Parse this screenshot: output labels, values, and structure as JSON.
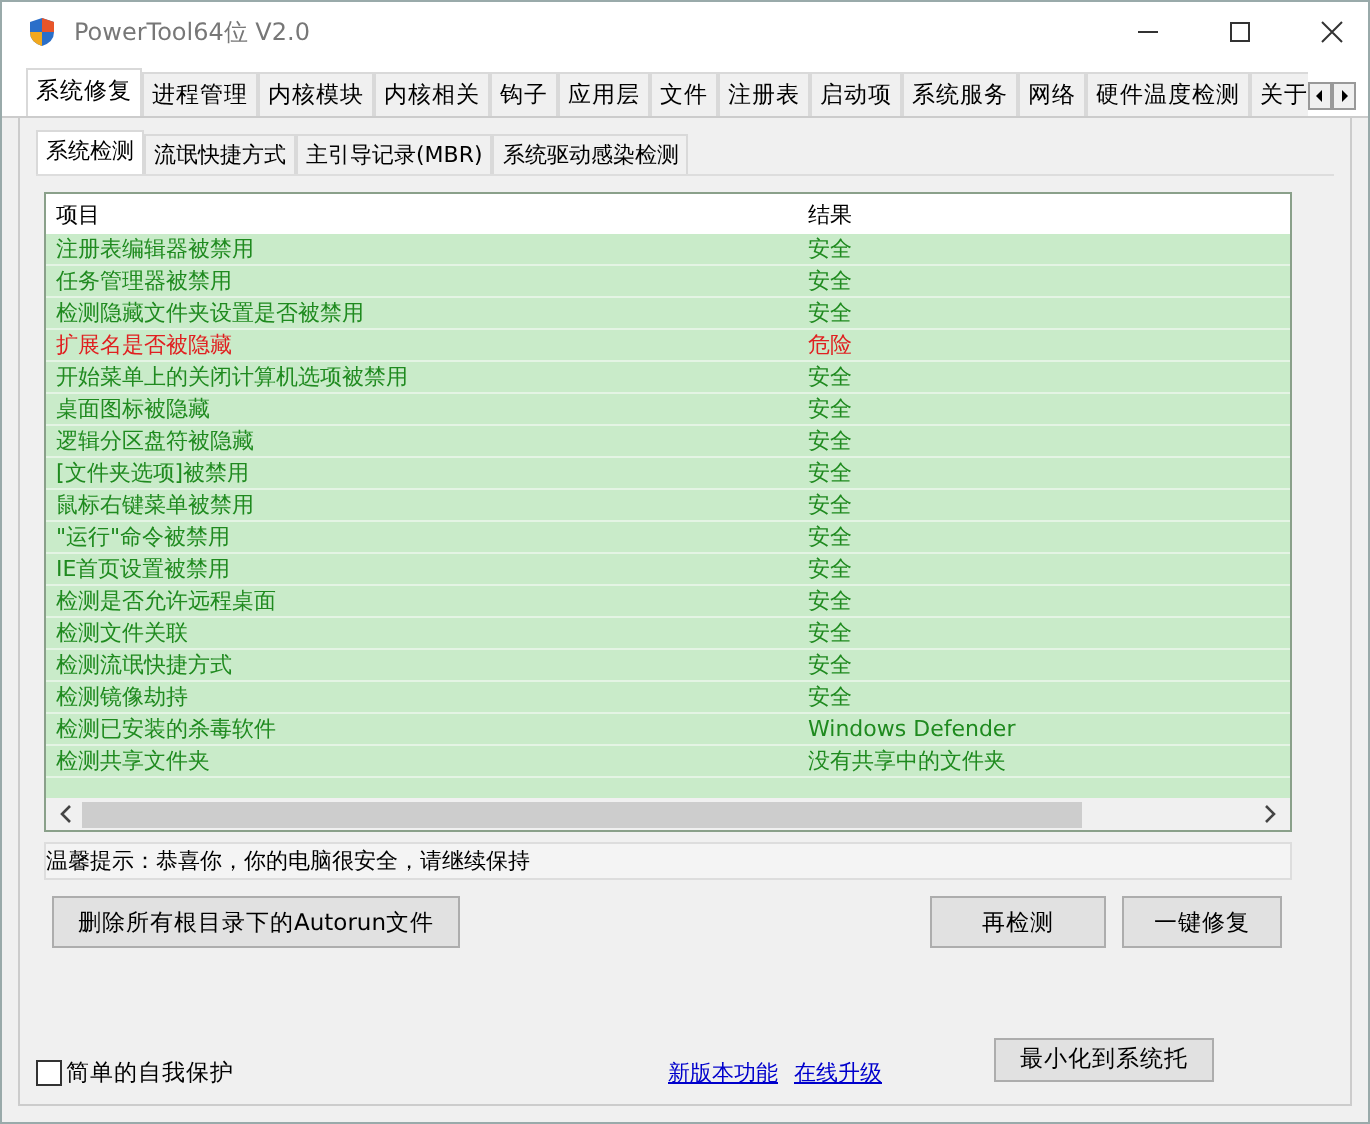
{
  "window": {
    "title": "PowerTool64位 V2.0"
  },
  "tabs": [
    {
      "label": "系统修复",
      "selected": true
    },
    {
      "label": "进程管理",
      "selected": false
    },
    {
      "label": "内核模块",
      "selected": false
    },
    {
      "label": "内核相关",
      "selected": false
    },
    {
      "label": "钩子",
      "selected": false
    },
    {
      "label": "应用层",
      "selected": false
    },
    {
      "label": "文件",
      "selected": false
    },
    {
      "label": "注册表",
      "selected": false
    },
    {
      "label": "启动项",
      "selected": false
    },
    {
      "label": "系统服务",
      "selected": false
    },
    {
      "label": "网络",
      "selected": false
    },
    {
      "label": "硬件温度检测",
      "selected": false
    },
    {
      "label": "关于",
      "selected": false
    }
  ],
  "sub_tabs": [
    {
      "label": "系统检测",
      "selected": true
    },
    {
      "label": "流氓快捷方式",
      "selected": false
    },
    {
      "label": "主引导记录(MBR)",
      "selected": false
    },
    {
      "label": "系统驱动感染检测",
      "selected": false
    }
  ],
  "table": {
    "columns": [
      "项目",
      "结果"
    ],
    "rows": [
      {
        "item": "注册表编辑器被禁用",
        "result": "安全",
        "danger": false
      },
      {
        "item": "任务管理器被禁用",
        "result": "安全",
        "danger": false
      },
      {
        "item": "检测隐藏文件夹设置是否被禁用",
        "result": "安全",
        "danger": false
      },
      {
        "item": "扩展名是否被隐藏",
        "result": "危险",
        "danger": true
      },
      {
        "item": "开始菜单上的关闭计算机选项被禁用",
        "result": "安全",
        "danger": false
      },
      {
        "item": "桌面图标被隐藏",
        "result": "安全",
        "danger": false
      },
      {
        "item": "逻辑分区盘符被隐藏",
        "result": "安全",
        "danger": false
      },
      {
        "item": "[文件夹选项]被禁用",
        "result": "安全",
        "danger": false
      },
      {
        "item": "鼠标右键菜单被禁用",
        "result": "安全",
        "danger": false
      },
      {
        "item": "\"运行\"命令被禁用",
        "result": "安全",
        "danger": false
      },
      {
        "item": "IE首页设置被禁用",
        "result": "安全",
        "danger": false
      },
      {
        "item": "检测是否允许远程桌面",
        "result": "安全",
        "danger": false
      },
      {
        "item": "检测文件关联",
        "result": "安全",
        "danger": false
      },
      {
        "item": "检测流氓快捷方式",
        "result": "安全",
        "danger": false
      },
      {
        "item": "检测镜像劫持",
        "result": "安全",
        "danger": false
      },
      {
        "item": "检测已安装的杀毒软件",
        "result": "Windows Defender",
        "danger": false
      },
      {
        "item": "检测共享文件夹",
        "result": "没有共享中的文件夹",
        "danger": false
      }
    ]
  },
  "tip": "温馨提示：恭喜你，你的电脑很安全，请继续保持",
  "buttons": {
    "delete_autorun": "删除所有根目录下的Autorun文件",
    "recheck": "再检测",
    "fix": "一键修复"
  },
  "self_protect": {
    "label": "简单的自我保护",
    "checked": false
  },
  "links": [
    "新版本功能",
    "在线升级"
  ],
  "minimize_button": "最小化到系统托"
}
